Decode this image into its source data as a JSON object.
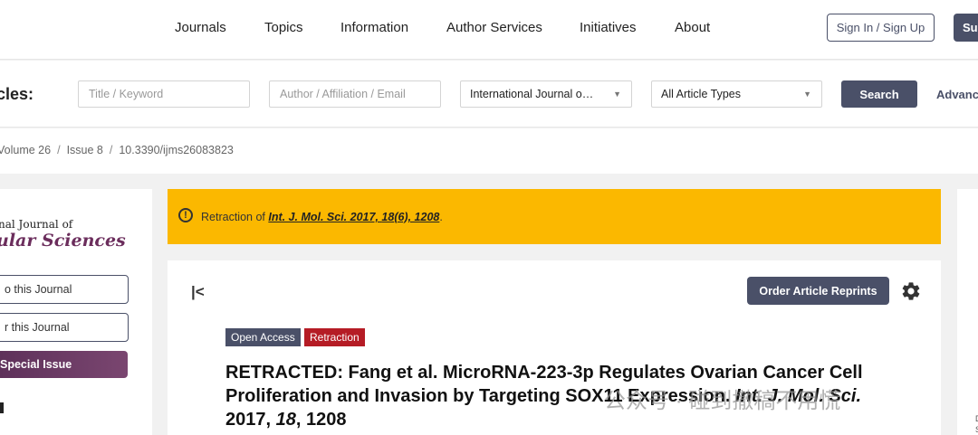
{
  "nav": {
    "items": [
      "Journals",
      "Topics",
      "Information",
      "Author Services",
      "Initiatives",
      "About"
    ],
    "sign_in": "Sign In / Sign Up",
    "submit": "Su"
  },
  "search": {
    "label": "cles:",
    "title_placeholder": "Title / Keyword",
    "author_placeholder": "Author / Affiliation / Email",
    "journal_value": "International Journal o…",
    "type_value": "All Article Types",
    "button": "Search",
    "advanced": "Advanc"
  },
  "breadcrumb": {
    "volume": "Volume 26",
    "issue": "Issue 8",
    "doi": "10.3390/ijms26083823"
  },
  "sidebar": {
    "logo_line1": "nal Journal of",
    "logo_line2": "ular Sciences",
    "about_btn": "o this Journal",
    "for_btn": "r this Journal",
    "special_btn": "Special Issue"
  },
  "banner": {
    "prefix": "Retraction of ",
    "link_journal": "Int. J. Mol. Sci.",
    "link_year": " 2017, ",
    "link_vol": "18",
    "link_rest": "(6), 1208",
    "suffix": "."
  },
  "article": {
    "order_reprints": "Order Article Reprints",
    "badge_open": "Open Access",
    "badge_type": "Retraction",
    "title_main": "RETRACTED: Fang et al. MicroRNA-223-3p Regulates Ovarian Cancer Cell Proliferation and Invasion by Targeting SOX11 Expression.",
    "title_journal": "Int. J. Mol. Sci.",
    "title_year": " 2017, ",
    "title_vol": "18",
    "title_pages": ", 1208"
  },
  "watermark": "公众号 · 碰到撤稿不用慌",
  "right_fragment": "D\nS",
  "colors": {
    "primary": "#4a5068",
    "banner": "#fbb800",
    "retraction": "#b51c25",
    "journal_brand": "#6b2d5c"
  },
  "icons": [
    "info-circle-icon",
    "collapse-left-icon",
    "gear-icon",
    "caret-down-icon"
  ]
}
